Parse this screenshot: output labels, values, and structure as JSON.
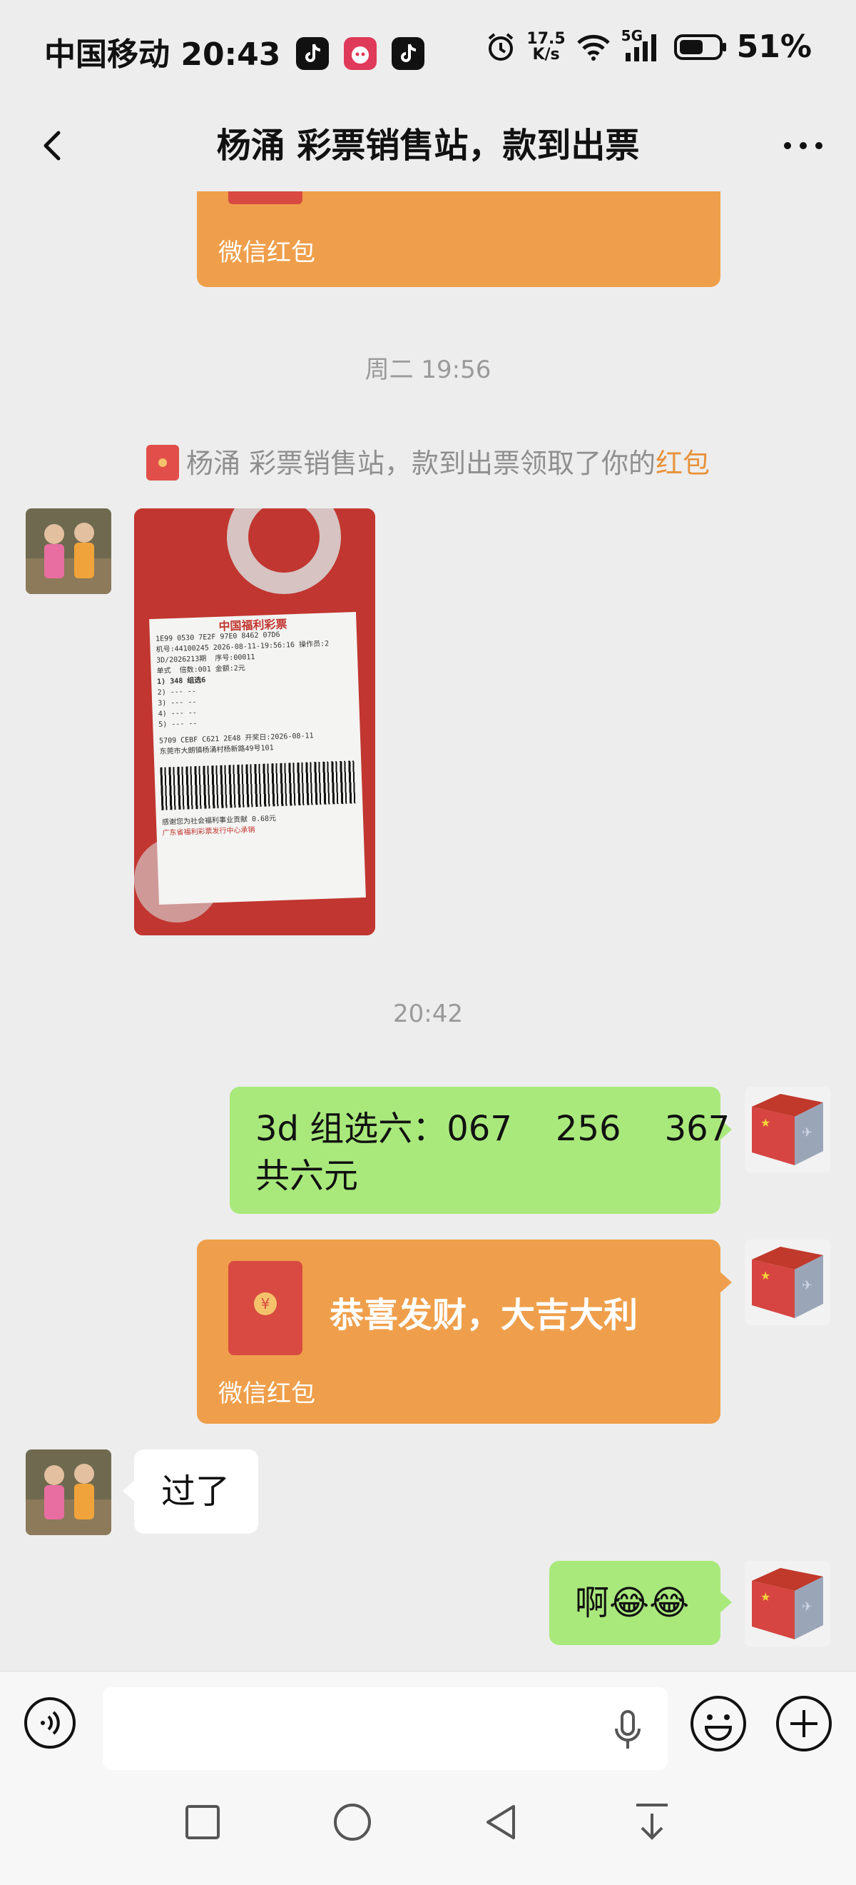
{
  "status_bar": {
    "carrier": "中国移动",
    "time": "20:43",
    "net_speed_value": "17.5",
    "net_speed_unit": "K/s",
    "network": "5G",
    "battery": "51%"
  },
  "header": {
    "title": "杨涌 彩票销售站，款到出票"
  },
  "messages": {
    "rp_top_label": "微信红包",
    "ts1": "周二 19:56",
    "system_notice_prefix": "杨涌 彩票销售站，款到出票领取了你的",
    "system_notice_link": "红包",
    "ticket": {
      "header": "中国福利彩票",
      "line1": "1E99 0530 7E2F 97E0 8462 07D6",
      "line2": "机号:44100245 2026-08-11-19:56:16 操作员:2",
      "line3": "3D/2026213期",
      "line3b": "序号:00011",
      "line4": "单式",
      "line4b": "倍数:001 金额:2元",
      "line5": "1) 348    组选6",
      "line6": "2) ---    --",
      "line7": "3) ---    --",
      "line8": "4) ---    --",
      "line9": "5) ---    --",
      "line10": "5709 CEBF C621 2E48 开奖日:2026-08-11",
      "line11": "东莞市大朗镇杨涌村杨新路49号101",
      "line12": "感谢您为社会福利事业贡献 0.68元",
      "line13": "广东省福利彩票发行中心承销"
    },
    "ts2": "20:42",
    "sent_text_line1": "3d 组选六：067    256    367",
    "sent_text_line2": "共六元",
    "rp_sent_title": "恭喜发财，大吉大利",
    "rp_sent_label": "微信红包",
    "rp_icon_char": "¥",
    "received_text": "过了",
    "sent_reply": "啊",
    "sent_reply_emojis": "😂😂"
  },
  "colors": {
    "green_bubble": "#a9e97c",
    "red_packet": "#ef9f4b",
    "link": "#e8923a"
  }
}
